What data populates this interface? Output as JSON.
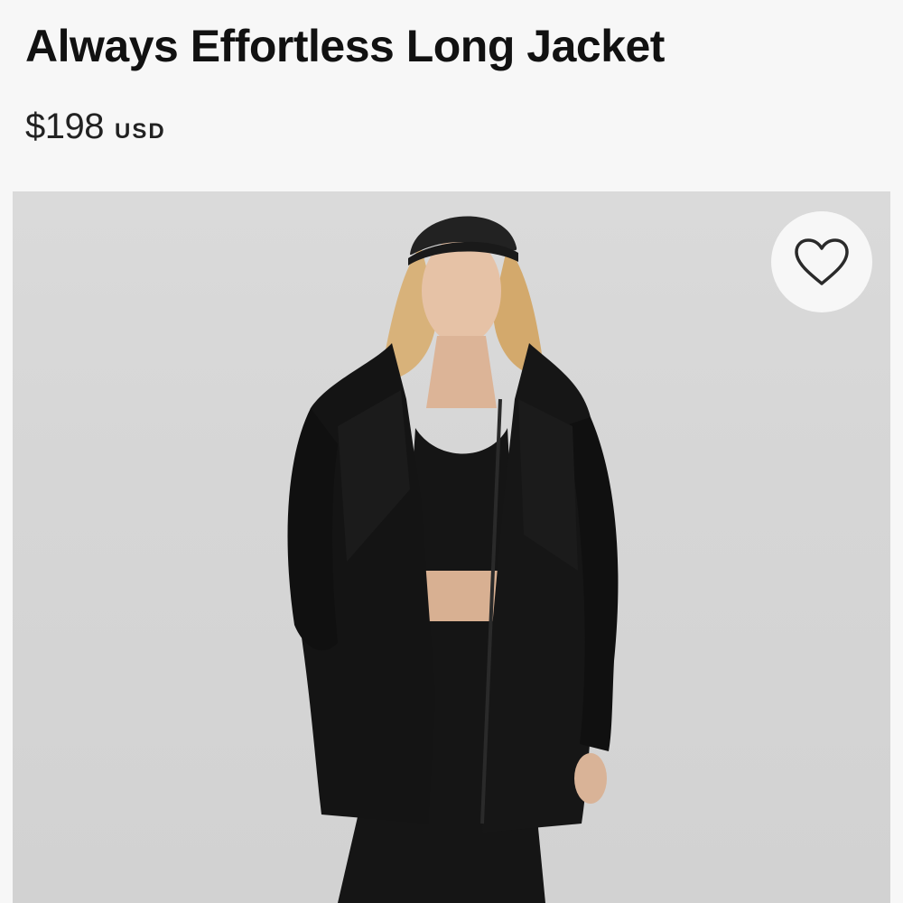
{
  "product": {
    "title": "Always Effortless Long Jacket",
    "price": "$198",
    "currency": "USD"
  },
  "gallery": {
    "background_color": "#d6d6d6",
    "product_color": "#111111"
  },
  "actions": {
    "wishlist_icon": "heart-outline-icon"
  }
}
